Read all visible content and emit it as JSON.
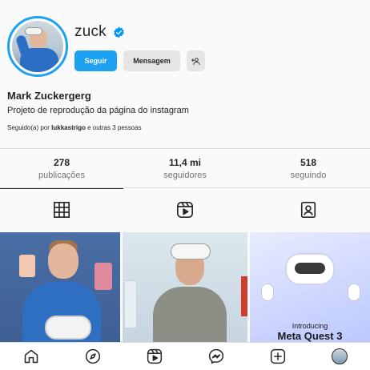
{
  "profile": {
    "username": "zuck",
    "full_name": "Mark Zuckergerg",
    "bio": "Projeto de reprodução da página do instagram",
    "followed_by_prefix": "Seguido(a) por",
    "followed_by_user": "lukkastrigo",
    "followed_by_suffix": "e outras 3 pessoas",
    "verified": true,
    "accent_color": "#1da1f2"
  },
  "actions": {
    "follow_label": "Seguir",
    "message_label": "Mensagem",
    "add_icon": "person-add-icon"
  },
  "stats": [
    {
      "value": "278",
      "label": "publicações"
    },
    {
      "value": "11,4 mi",
      "label": "seguidores"
    },
    {
      "value": "518",
      "label": "seguindo"
    }
  ],
  "tabs": [
    {
      "name": "posts",
      "icon": "grid-icon",
      "active": true
    },
    {
      "name": "reels",
      "icon": "reels-icon",
      "active": false
    },
    {
      "name": "tagged",
      "icon": "tagged-icon",
      "active": false
    }
  ],
  "posts": [
    {
      "caption_small": "",
      "caption_large": ""
    },
    {
      "caption_small": "",
      "caption_large": ""
    },
    {
      "caption_small": "Introducing",
      "caption_large": "Meta Quest 3"
    }
  ],
  "bottom_nav": [
    "home-icon",
    "explore-icon",
    "reels-icon",
    "messenger-icon",
    "new-post-icon",
    "profile-avatar"
  ]
}
